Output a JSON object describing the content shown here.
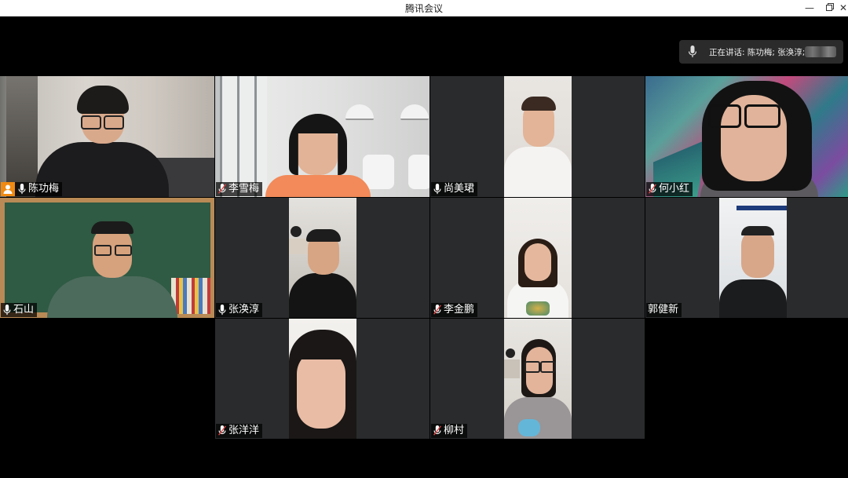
{
  "window": {
    "title": "腾讯会议"
  },
  "speaking": {
    "label": "正在讲话: 陈功梅; 张涣淳;"
  },
  "participants": [
    {
      "name": "陈功梅",
      "mic": "on",
      "host": true
    },
    {
      "name": "李雪梅",
      "mic": "muted"
    },
    {
      "name": "尚美珺",
      "mic": "on"
    },
    {
      "name": "何小红",
      "mic": "muted"
    },
    {
      "name": "石山",
      "mic": "on"
    },
    {
      "name": "张涣淳",
      "mic": "on"
    },
    {
      "name": "李金鹏",
      "mic": "muted"
    },
    {
      "name": "郭健新",
      "mic": "none"
    },
    {
      "name": "张洋洋",
      "mic": "muted"
    },
    {
      "name": "柳村",
      "mic": "muted"
    }
  ],
  "icons": [
    "mic-icon",
    "mic-muted-icon",
    "host-icon",
    "minimize-icon",
    "restore-icon",
    "close-icon"
  ],
  "colors": {
    "tile_bg": "#2a2b2d",
    "active_border": "#2e9c5a",
    "host_badge": "#f08a12"
  }
}
